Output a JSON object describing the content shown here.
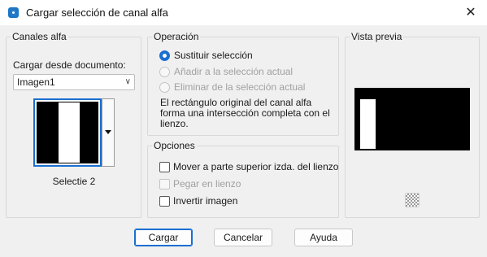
{
  "window": {
    "title": "Cargar selección de canal alfa",
    "close": "✕"
  },
  "canales": {
    "group_label": "Canales alfa",
    "load_from_label": "Cargar desde documento:",
    "document_value": "Imagen1",
    "thumb_caption": "Selectie 2"
  },
  "operacion": {
    "group_label": "Operación",
    "options": [
      {
        "label": "Sustituir selección",
        "checked": true,
        "disabled": false
      },
      {
        "label": "Añadir a la selección actual",
        "checked": false,
        "disabled": true
      },
      {
        "label": "Eliminar de la selección actual",
        "checked": false,
        "disabled": true
      }
    ],
    "description": "El rectángulo original del canal alfa forma una intersección completa con el lienzo."
  },
  "opciones": {
    "group_label": "Opciones",
    "checks": [
      {
        "label": "Mover a parte superior izda. del lienzo",
        "checked": false,
        "disabled": false
      },
      {
        "label": "Pegar en lienzo",
        "checked": false,
        "disabled": true
      },
      {
        "label": "Invertir imagen",
        "checked": false,
        "disabled": false
      }
    ]
  },
  "vista": {
    "group_label": "Vista previa",
    "zoom_icon": "checkerboard-icon"
  },
  "buttons": {
    "cargar": "Cargar",
    "cancelar": "Cancelar",
    "ayuda": "Ayuda"
  },
  "colors": {
    "accent": "#1b6fd0",
    "preview_bg": "#000000"
  }
}
